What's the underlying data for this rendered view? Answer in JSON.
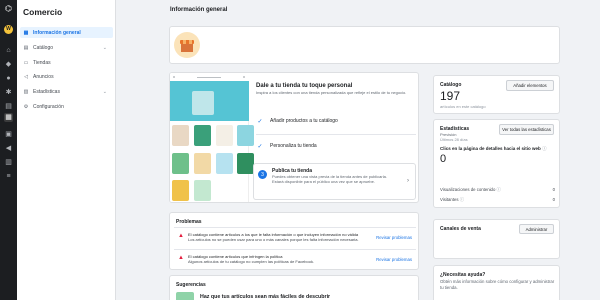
{
  "rail": {
    "avatar_letter": "W",
    "icons": [
      "meta-logo-icon",
      "home-icon",
      "bell-icon",
      "chat-icon",
      "gear-icon",
      "list-icon",
      "calendar-icon",
      "shop-icon",
      "megaphone-icon",
      "chart-icon",
      "menu-icon"
    ]
  },
  "sidebar": {
    "title": "Comercio",
    "items": [
      {
        "label": "Información general",
        "active": true,
        "expandable": false
      },
      {
        "label": "Catálogo",
        "active": false,
        "expandable": true
      },
      {
        "label": "Tiendas",
        "active": false,
        "expandable": false
      },
      {
        "label": "Anuncios",
        "active": false,
        "expandable": false
      },
      {
        "label": "Estadísticas",
        "active": false,
        "expandable": true
      },
      {
        "label": "Configuración",
        "active": false,
        "expandable": false
      }
    ]
  },
  "main": {
    "title": "Información general",
    "personalize": {
      "title": "Dale a tu tienda tu toque personal",
      "subtitle": "Inspira a los clientes con una tienda personalizada que refleje el estilo de tu negocio.",
      "publish": {
        "step": "3",
        "title": "Publica tu tienda",
        "description": "Puedes obtener una vista previa de la tienda antes de publicarla. Estará disponible para el público una vez que se apruebe."
      },
      "steps": [
        {
          "label": "Añadir productos a tu catálogo"
        },
        {
          "label": "Personaliza tu tienda"
        }
      ]
    },
    "problems": {
      "title": "Problemas",
      "items": [
        {
          "text": "El catálogo contiene artículos a los que le falta información o que incluyen información no válida",
          "detail": "Los artículos no se pueden usar para uno o más canales porque les falta información necesaria.",
          "link": "Revisar problemas"
        },
        {
          "text": "El catálogo contiene artículos que infringen la política",
          "detail": "Algunos artículos de tu catálogo no cumplen las políticas de Facebook.",
          "link": "Revisar problemas"
        }
      ]
    },
    "suggestions": {
      "title": "Sugerencias",
      "item": "Haz que tus artículos sean más fáciles de descubrir"
    }
  },
  "right": {
    "catalog": {
      "label": "Catálogo",
      "count": "197",
      "sub": "artículos en este catálogo",
      "button": "Añadir elementos"
    },
    "stats": {
      "label": "Estadísticas",
      "button": "Ver todas las estadísticas",
      "period": "Previsión",
      "range": "Últimos 28 días",
      "clicks_label": "Clics en la página de detalles hacia el sitio web",
      "clicks_value": "0",
      "rows": [
        {
          "label": "Visualizaciones de contenido",
          "value": "0"
        },
        {
          "label": "Visitantes",
          "value": "0"
        }
      ]
    },
    "sales": {
      "label": "Canales de venta",
      "button": "Administrar"
    },
    "help": {
      "label": "¿Necesitas ayuda?",
      "text": "Obtén más información sobre cómo configurar y administrar tu tienda."
    }
  }
}
